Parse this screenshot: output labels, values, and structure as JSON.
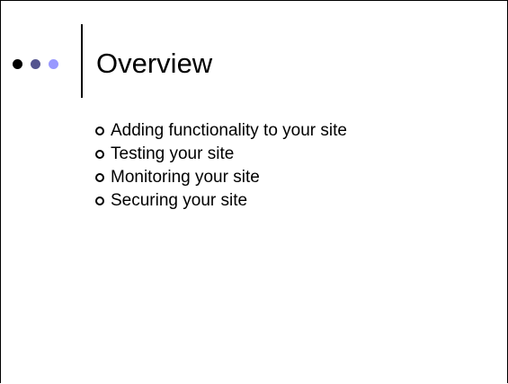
{
  "slide": {
    "title": "Overview",
    "dots": [
      {
        "color": "#000000"
      },
      {
        "color": "#55558f"
      },
      {
        "color": "#9999ff"
      }
    ],
    "bullets": [
      "Adding functionality to your site",
      "Testing your site",
      "Monitoring your site",
      "Securing your site"
    ]
  }
}
